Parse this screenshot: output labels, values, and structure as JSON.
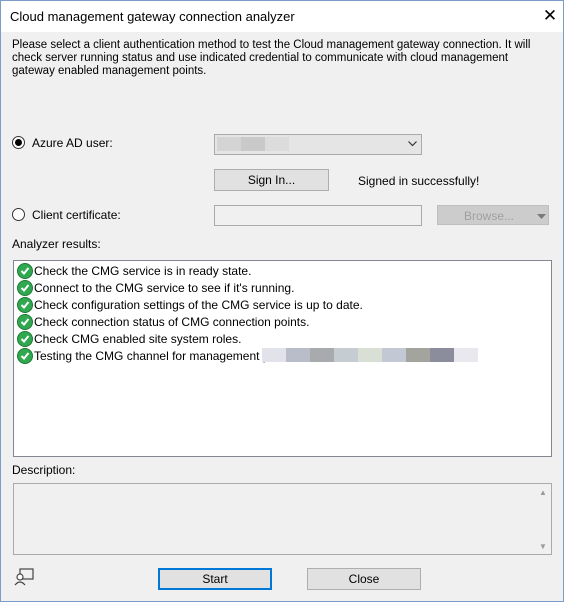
{
  "window": {
    "title": "Cloud management gateway connection analyzer",
    "close_glyph": "✕"
  },
  "intro": "Please select a client authentication method to test the Cloud management gateway connection. It will check server running status and use indicated credential to communicate with cloud management gateway enabled management points.",
  "auth": {
    "azure_label": "Azure AD user:",
    "azure_selected": true,
    "azure_user_value": "",
    "sign_in_label": "Sign In...",
    "signin_status": "Signed in successfully!",
    "cert_label": "Client certificate:",
    "cert_value": "",
    "browse_label": "Browse..."
  },
  "results": {
    "label": "Analyzer results:",
    "items": [
      {
        "text": "Check the CMG service is in ready state.",
        "status_icon": "check-icon"
      },
      {
        "text": "Connect to the CMG service to see if it's running.",
        "status_icon": "check-icon"
      },
      {
        "text": "Check configuration settings of the CMG service is up to date.",
        "status_icon": "check-icon"
      },
      {
        "text": "Check connection status of CMG connection points.",
        "status_icon": "check-icon"
      },
      {
        "text": "Check CMG enabled site system roles.",
        "status_icon": "check-icon"
      },
      {
        "text": "Testing the CMG channel for management point:",
        "status_icon": "check-icon"
      }
    ]
  },
  "description": {
    "label": "Description:",
    "value": ""
  },
  "footer": {
    "start_label": "Start",
    "close_label": "Close"
  },
  "colors": {
    "accent": "#0078d7",
    "success": "#2fa84f"
  }
}
